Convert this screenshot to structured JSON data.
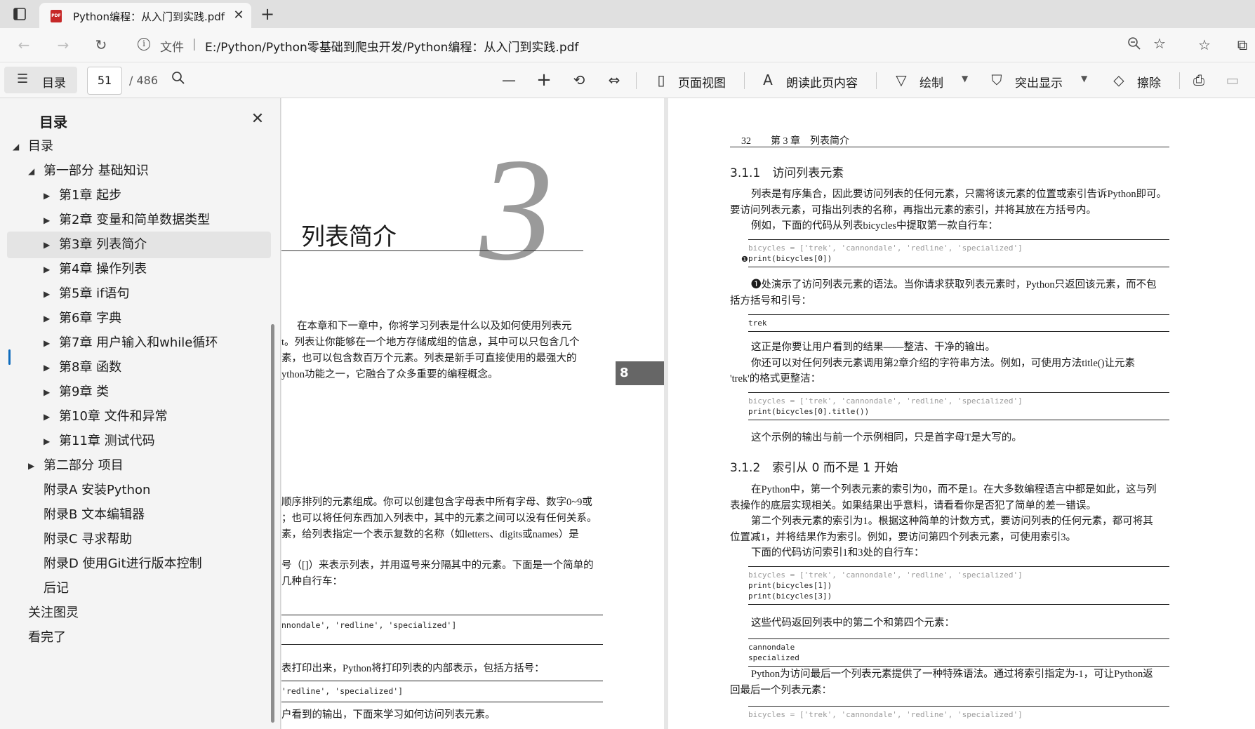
{
  "browser": {
    "tab_title": "Python编程：从入门到实践.pdf",
    "tab_icon": "PDF",
    "close_glyph": "✕",
    "newtab_glyph": "+",
    "address": {
      "scheme_label": "文件",
      "separator": "|",
      "url": "E:/Python/Python零基础到爬虫开发/Python编程：从入门到实践.pdf"
    }
  },
  "pdf_toolbar": {
    "toc_label": "目录",
    "page_current": "51",
    "page_total": "/ 486",
    "page_view_label": "页面视图",
    "read_aloud_label": "朗读此页内容",
    "draw_label": "绘制",
    "highlight_label": "突出显示",
    "erase_label": "擦除"
  },
  "sidebar": {
    "title": "目录",
    "items": [
      {
        "label": "目录",
        "level": 0,
        "state": "expanded"
      },
      {
        "label": "第一部分 基础知识",
        "level": 1,
        "state": "expanded"
      },
      {
        "label": "第1章 起步",
        "level": 2,
        "state": "collapsed"
      },
      {
        "label": "第2章 变量和简单数据类型",
        "level": 2,
        "state": "collapsed"
      },
      {
        "label": "第3章 列表简介",
        "level": 2,
        "state": "collapsed",
        "selected": true
      },
      {
        "label": "第4章 操作列表",
        "level": 2,
        "state": "collapsed"
      },
      {
        "label": "第5章 if语句",
        "level": 2,
        "state": "collapsed"
      },
      {
        "label": "第6章 字典",
        "level": 2,
        "state": "collapsed"
      },
      {
        "label": "第7章 用户输入和while循环",
        "level": 2,
        "state": "collapsed"
      },
      {
        "label": "第8章 函数",
        "level": 2,
        "state": "collapsed"
      },
      {
        "label": "第9章 类",
        "level": 2,
        "state": "collapsed"
      },
      {
        "label": "第10章 文件和异常",
        "level": 2,
        "state": "collapsed"
      },
      {
        "label": "第11章 测试代码",
        "level": 2,
        "state": "collapsed"
      },
      {
        "label": "第二部分 项目",
        "level": 1,
        "state": "collapsed"
      },
      {
        "label": "附录A 安装Python",
        "level": 1,
        "state": "leaf"
      },
      {
        "label": "附录B 文本编辑器",
        "level": 1,
        "state": "leaf"
      },
      {
        "label": "附录C 寻求帮助",
        "level": 1,
        "state": "leaf"
      },
      {
        "label": "附录D 使用Git进行版本控制",
        "level": 1,
        "state": "leaf"
      },
      {
        "label": "后记",
        "level": 1,
        "state": "leaf"
      },
      {
        "label": "关注图灵",
        "level": 0,
        "state": "leaf"
      },
      {
        "label": "看完了",
        "level": 0,
        "state": "leaf"
      }
    ]
  },
  "left_page": {
    "chapter_number": "3",
    "chapter_title": "列表简介",
    "intro_lines": [
      "在本章和下一章中，你将学习列表是什么以及如何使用列表元",
      "t。列表让你能够在一个地方存储成组的信息，其中可以只包含几个",
      "素，也可以包含数百万个元素。列表是新手可直接使用的最强大的",
      "ython功能之一，它融合了众多重要的编程概念。"
    ],
    "body_lines_1": [
      "顺序排列的元素组成。你可以创建包含字母表中所有字母、数字0~9或",
      "；也可以将任何东西加入列表中，其中的元素之间可以没有任何关系。",
      "素，给列表指定一个表示复数的名称（如letters、digits或names）是"
    ],
    "body_lines_2": [
      "号（[]）来表示列表，并用逗号来分隔其中的元素。下面是一个简单的",
      "几种自行车："
    ],
    "code_1": "nnondale', 'redline', 'specialized']",
    "body_line_3": "表打印出来，Python将打印列表的内部表示，包括方括号：",
    "code_2": "'redline', 'specialized']",
    "body_line_4": "户看到的输出，下面来学习如何访问列表元素。",
    "page_badge": "8"
  },
  "right_page": {
    "header": "32　　第 3 章　列表简介",
    "sec1_title": "3.1.1　访问列表元素",
    "sec1_para1": [
      "列表是有序集合，因此要访问列表的任何元素，只需将该元素的位置或索引告诉Python即可。",
      "要访问列表元素，可指出列表的名称，再指出元素的索引，并将其放在方括号内。",
      "例如，下面的代码从列表bicycles中提取第一款自行车："
    ],
    "code1": [
      "bicycles = ['trek', 'cannondale', 'redline', 'specialized']",
      "print(bicycles[0])"
    ],
    "code1_marker": "❶",
    "sec1_para2": [
      "❶处演示了访问列表元素的语法。当你请求获取列表元素时，Python只返回该元素，而不包",
      "括方括号和引号："
    ],
    "output1": [
      "trek"
    ],
    "sec1_para3": [
      "这正是你要让用户看到的结果——整洁、干净的输出。",
      "你还可以对任何列表元素调用第2章介绍的字符串方法。例如，可使用方法title()让元素",
      "'trek'的格式更整洁："
    ],
    "code2": [
      "bicycles = ['trek', 'cannondale', 'redline', 'specialized']",
      "print(bicycles[0].title())"
    ],
    "sec1_para4": "这个示例的输出与前一个示例相同，只是首字母T是大写的。",
    "sec2_title": "3.1.2　索引从 0 而不是 1 开始",
    "sec2_para1": [
      "在Python中，第一个列表元素的索引为0，而不是1。在大多数编程语言中都是如此，这与列",
      "表操作的底层实现相关。如果结果出乎意料，请看看你是否犯了简单的差一错误。",
      "第二个列表元素的索引为1。根据这种简单的计数方式，要访问列表的任何元素，都可将其",
      "位置减1，并将结果作为索引。例如，要访问第四个列表元素，可使用索引3。",
      "下面的代码访问索引1和3处的自行车："
    ],
    "code3": [
      "bicycles = ['trek', 'cannondale', 'redline', 'specialized']",
      "print(bicycles[1])",
      "print(bicycles[3])"
    ],
    "sec2_para2": "这些代码返回列表中的第二个和第四个元素：",
    "output2": [
      "cannondale",
      "specialized"
    ],
    "sec2_para3": [
      "Python为访问最后一个列表元素提供了一种特殊语法。通过将索引指定为-1，可让Python返",
      "回最后一个列表元素："
    ],
    "code4": [
      "bicycles = ['trek', 'cannondale', 'redline', 'specialized']"
    ]
  }
}
